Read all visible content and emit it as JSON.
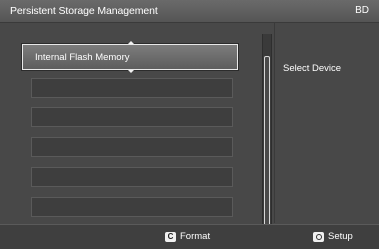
{
  "header": {
    "title": "Persistent Storage Management",
    "badge": "BD"
  },
  "list": {
    "items": [
      {
        "label": "Internal Flash Memory",
        "selected": true
      },
      {
        "label": ""
      },
      {
        "label": ""
      },
      {
        "label": ""
      },
      {
        "label": ""
      },
      {
        "label": ""
      }
    ]
  },
  "side_panel": {
    "label": "Select Device"
  },
  "footer": {
    "format": {
      "key": "C",
      "label": "Format"
    },
    "setup": {
      "key_icon": "setup-key-icon",
      "label": "Setup"
    }
  }
}
